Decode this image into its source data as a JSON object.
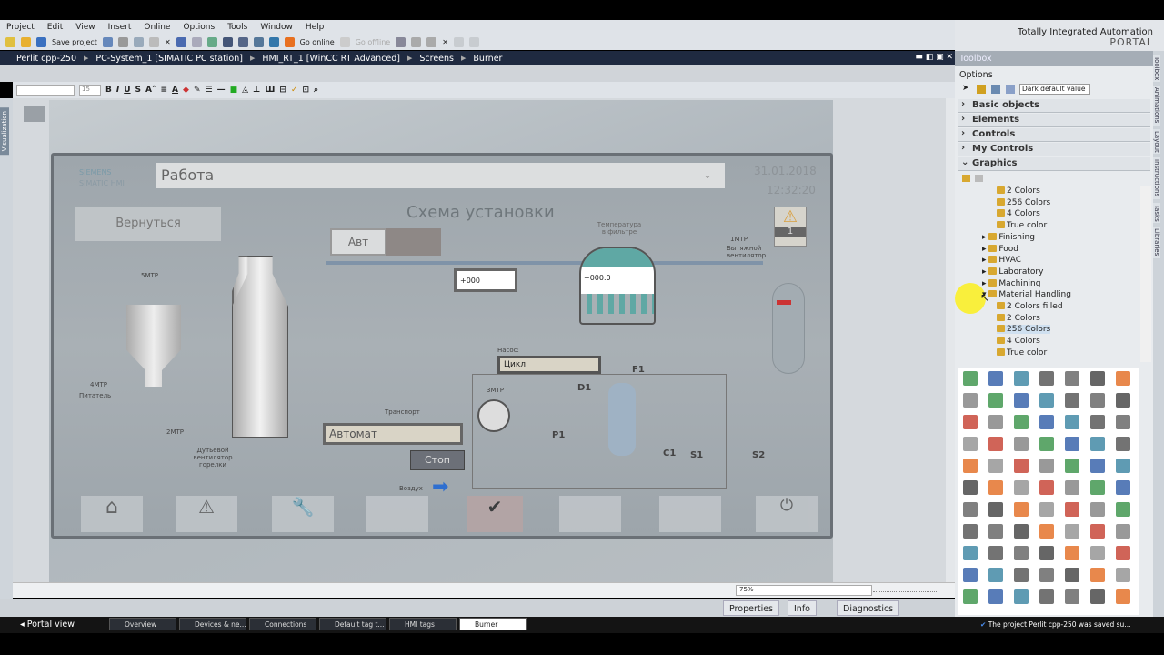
{
  "menu": [
    "Project",
    "Edit",
    "View",
    "Insert",
    "Online",
    "Options",
    "Tools",
    "Window",
    "Help"
  ],
  "brand": {
    "line1": "Totally Integrated Automation",
    "line2": "PORTAL"
  },
  "toolbar": {
    "save_project": "Save project",
    "go_online": "Go online",
    "go_offline": "Go offline"
  },
  "breadcrumb": [
    "Perlit cpp-250",
    "PC-System_1 [SIMATIC PC station]",
    "HMI_RT_1 [WinCC RT Advanced]",
    "Screens",
    "Burner"
  ],
  "format": {
    "font_size": "15"
  },
  "left_tab": "Visualization",
  "hmi": {
    "siemens": "SIEMENS",
    "simatic": "SIMATIC HMI",
    "status": "Работа",
    "date": "31.01.2018",
    "time": "12:32:20",
    "back": "Вернуться",
    "title": "Схема установки",
    "auto": "Авт",
    "alarm_count": "1",
    "value1": "+000",
    "value2": "+000.0",
    "temp_label": "Температура в фильтре",
    "m5": "5МТР",
    "m4": "4МТР",
    "feeder": "Питатель",
    "m2": "2МТР",
    "fan": "Дутьевой вентилятор горелки",
    "m1": "1МТР",
    "exhaust": "Вытяжной вентилятор",
    "pump_label": "Насос:",
    "pump_mode": "Цикл",
    "transport": "Транспорт",
    "transport_mode": "Автомат",
    "stop": "Стоп",
    "air": "Воздух",
    "m3": "3МТР",
    "f1": "F1",
    "d1": "D1",
    "p1": "P1",
    "c1": "C1",
    "s1": "S1",
    "s2": "S2"
  },
  "zoom": "75%",
  "bottom_tabs": {
    "properties": "Properties",
    "info": "Info",
    "diagnostics": "Diagnostics"
  },
  "taskbar": {
    "portal_view": "Portal view",
    "tasks": [
      "Overview",
      "Devices & ne...",
      "Connections",
      "Default tag t...",
      "HMI tags",
      "Burner"
    ],
    "status": "The project Perlit cpp-250 was saved su..."
  },
  "toolbox": {
    "title": "Toolbox",
    "options": "Options",
    "style_select": "Dark default value",
    "sections": [
      "Basic objects",
      "Elements",
      "Controls",
      "My Controls",
      "Graphics"
    ],
    "tree": [
      {
        "label": "2 Colors",
        "level": 2
      },
      {
        "label": "256 Colors",
        "level": 2
      },
      {
        "label": "4 Colors",
        "level": 2
      },
      {
        "label": "True color",
        "level": 2
      },
      {
        "label": "Finishing",
        "level": 1
      },
      {
        "label": "Food",
        "level": 1
      },
      {
        "label": "HVAC",
        "level": 1
      },
      {
        "label": "Laboratory",
        "level": 1
      },
      {
        "label": "Machining",
        "level": 1
      },
      {
        "label": "Material Handling",
        "level": 1,
        "expanded": true
      },
      {
        "label": "2 Colors filled",
        "level": 2
      },
      {
        "label": "2 Colors",
        "level": 2
      },
      {
        "label": "256 Colors",
        "level": 2,
        "selected": true
      },
      {
        "label": "4 Colors",
        "level": 2
      },
      {
        "label": "True color",
        "level": 2
      }
    ]
  },
  "side_tabs": [
    "Toolbox",
    "Animations",
    "Layout",
    "Instructions",
    "Tasks",
    "Libraries"
  ],
  "colors": {
    "breadcrumb_bg": "#1f2a40",
    "accent_blue": "#2f6fd0",
    "alarm_yellow": "#e8a020"
  }
}
